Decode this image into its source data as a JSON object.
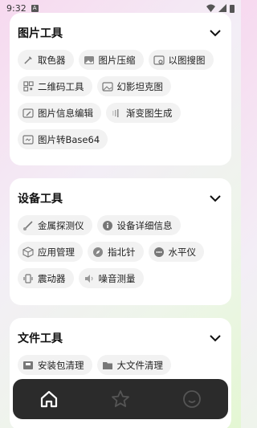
{
  "status": {
    "time": "9:32",
    "notif": "A"
  },
  "sections": [
    {
      "title": "图片工具",
      "items": [
        {
          "label": "取色器",
          "icon": "eyedropper-icon"
        },
        {
          "label": "图片压缩",
          "icon": "image-icon"
        },
        {
          "label": "以图搜图",
          "icon": "image-search-icon"
        },
        {
          "label": "二维码工具",
          "icon": "qrcode-icon"
        },
        {
          "label": "幻影坦克图",
          "icon": "image-icon"
        },
        {
          "label": "图片信息编辑",
          "icon": "image-edit-icon"
        },
        {
          "label": "渐变图生成",
          "icon": "gradient-icon"
        },
        {
          "label": "图片转Base64",
          "icon": "image-code-icon"
        }
      ]
    },
    {
      "title": "设备工具",
      "items": [
        {
          "label": "金属探测仪",
          "icon": "metal-detector-icon"
        },
        {
          "label": "设备详细信息",
          "icon": "info-icon"
        },
        {
          "label": "应用管理",
          "icon": "cube-icon"
        },
        {
          "label": "指北针",
          "icon": "compass-icon"
        },
        {
          "label": "水平仪",
          "icon": "level-icon"
        },
        {
          "label": "震动器",
          "icon": "vibrate-icon"
        },
        {
          "label": "噪音测量",
          "icon": "sound-icon"
        }
      ]
    },
    {
      "title": "文件工具",
      "items": [
        {
          "label": "安装包清理",
          "icon": "package-icon"
        },
        {
          "label": "大文件清理",
          "icon": "folder-icon"
        }
      ]
    }
  ],
  "nav": [
    "home-icon",
    "star-icon",
    "smiley-icon"
  ]
}
